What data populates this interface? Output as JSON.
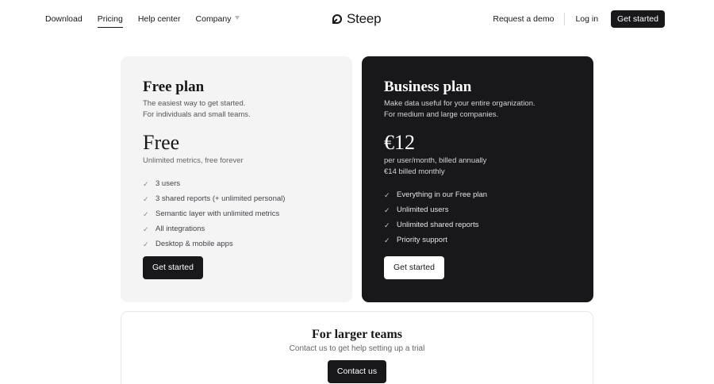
{
  "nav": {
    "links": [
      {
        "label": "Download",
        "active": false
      },
      {
        "label": "Pricing",
        "active": true
      },
      {
        "label": "Help center",
        "active": false
      },
      {
        "label": "Company",
        "active": false
      }
    ],
    "brand": "Steep",
    "request_demo": "Request a demo",
    "login": "Log in",
    "get_started": "Get started"
  },
  "plans": {
    "free": {
      "title": "Free plan",
      "subtitle_1": "The easiest way to get started.",
      "subtitle_2": "For individuals and small teams.",
      "price": "Free",
      "price_note": "Unlimited metrics, free forever",
      "features": [
        "3 users",
        "3 shared reports (+ unlimited personal)",
        "Semantic layer with unlimited metrics",
        "All integrations",
        "Desktop & mobile apps"
      ],
      "button": "Get started"
    },
    "business": {
      "title": "Business plan",
      "subtitle_1": "Make data useful for your entire organization.",
      "subtitle_2": "For medium and large companies.",
      "price": "€12",
      "price_note_1": "per user/month, billed annually",
      "price_note_2": "€14 billed monthly",
      "features": [
        "Everything in our Free plan",
        "Unlimited users",
        "Unlimited shared reports",
        "Priority support"
      ],
      "button": "Get started"
    }
  },
  "teams": {
    "title": "For larger teams",
    "subtitle": "Contact us to get help setting up a trial",
    "button": "Contact us"
  },
  "icons": {
    "check": "check-icon",
    "logo": "steep-logo-icon",
    "caret": "caret-down-icon"
  }
}
